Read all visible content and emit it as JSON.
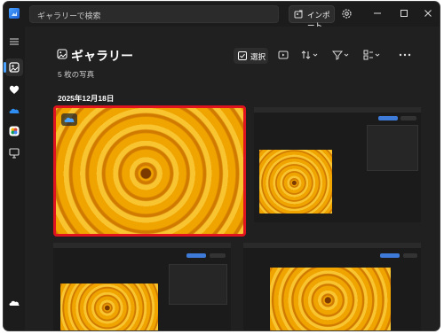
{
  "titlebar": {
    "search_placeholder": "ギャラリーで検索",
    "import_label": "インポート"
  },
  "page": {
    "title": "ギャラリー",
    "photo_count": "5 枚の写真",
    "date_header": "2025年12月18日"
  },
  "toolbar": {
    "select_label": "選択"
  },
  "sidebar": {
    "items": [
      "menu",
      "gallery",
      "favorites",
      "onedrive",
      "icloud",
      "this-pc",
      "cloud-bottom"
    ]
  },
  "colors": {
    "accent": "#4aa3ff",
    "selection_border": "#e0141e",
    "background": "#202020"
  }
}
